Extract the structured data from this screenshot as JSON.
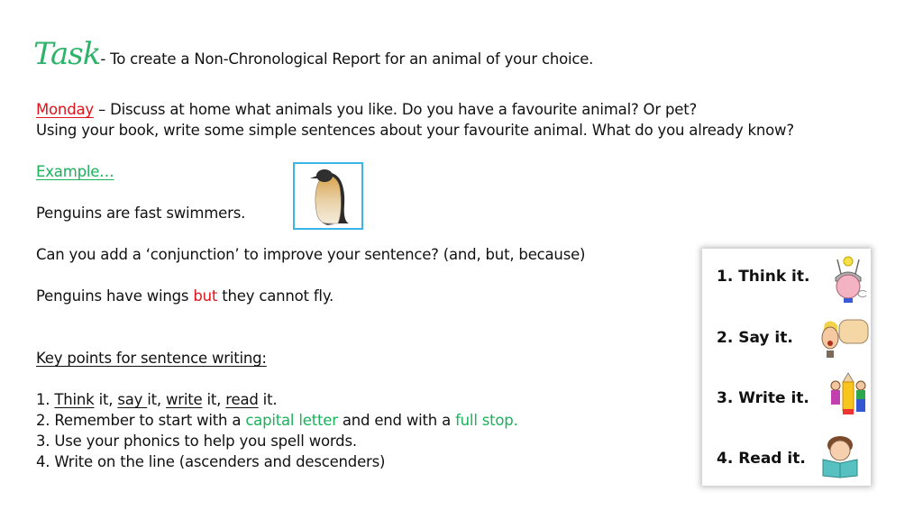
{
  "header": {
    "task_word": "Task",
    "task_text": "- To create a Non-Chronological Report for an animal of your choice."
  },
  "monday": {
    "label": "Monday",
    "line1": " – Discuss at home what animals you like. Do you have a favourite animal? Or pet?",
    "line2": "Using your book, write some simple sentences about your favourite animal. What do you already know?"
  },
  "example": {
    "label": "Example…",
    "sentence": "Penguins are fast swimmers.",
    "image": "penguin-image"
  },
  "conjunction": {
    "question": "Can you add a ‘conjunction’ to improve your sentence?   (and, but, because)",
    "example_start": "Penguins have wings ",
    "example_conj": "but",
    "example_end": " they cannot fly."
  },
  "key_points": {
    "heading": "Key points for sentence writing:",
    "p1": {
      "num": "1. ",
      "think": "Think",
      "t1": " it, ",
      "say": "say ",
      "t2": "it, ",
      "write": "write",
      "t3": " it, ",
      "read": "read",
      "t4": " it."
    },
    "p2": {
      "start": "2. Remember to start with a ",
      "cap": "capital letter",
      "mid": " and end with a ",
      "stop": "full stop."
    },
    "p3": "3. Use your phonics to help you spell words.",
    "p4": "4. Write on the line (ascenders and descenders)"
  },
  "steps_card": {
    "items": [
      {
        "label": "1.  Think it.",
        "icon": "thinking-head-icon"
      },
      {
        "label": "2.  Say it.",
        "icon": "speaking-person-icon"
      },
      {
        "label": "3.  Write it.",
        "icon": "children-pencil-icon"
      },
      {
        "label": "4.  Read it.",
        "icon": "reading-child-icon"
      }
    ]
  }
}
